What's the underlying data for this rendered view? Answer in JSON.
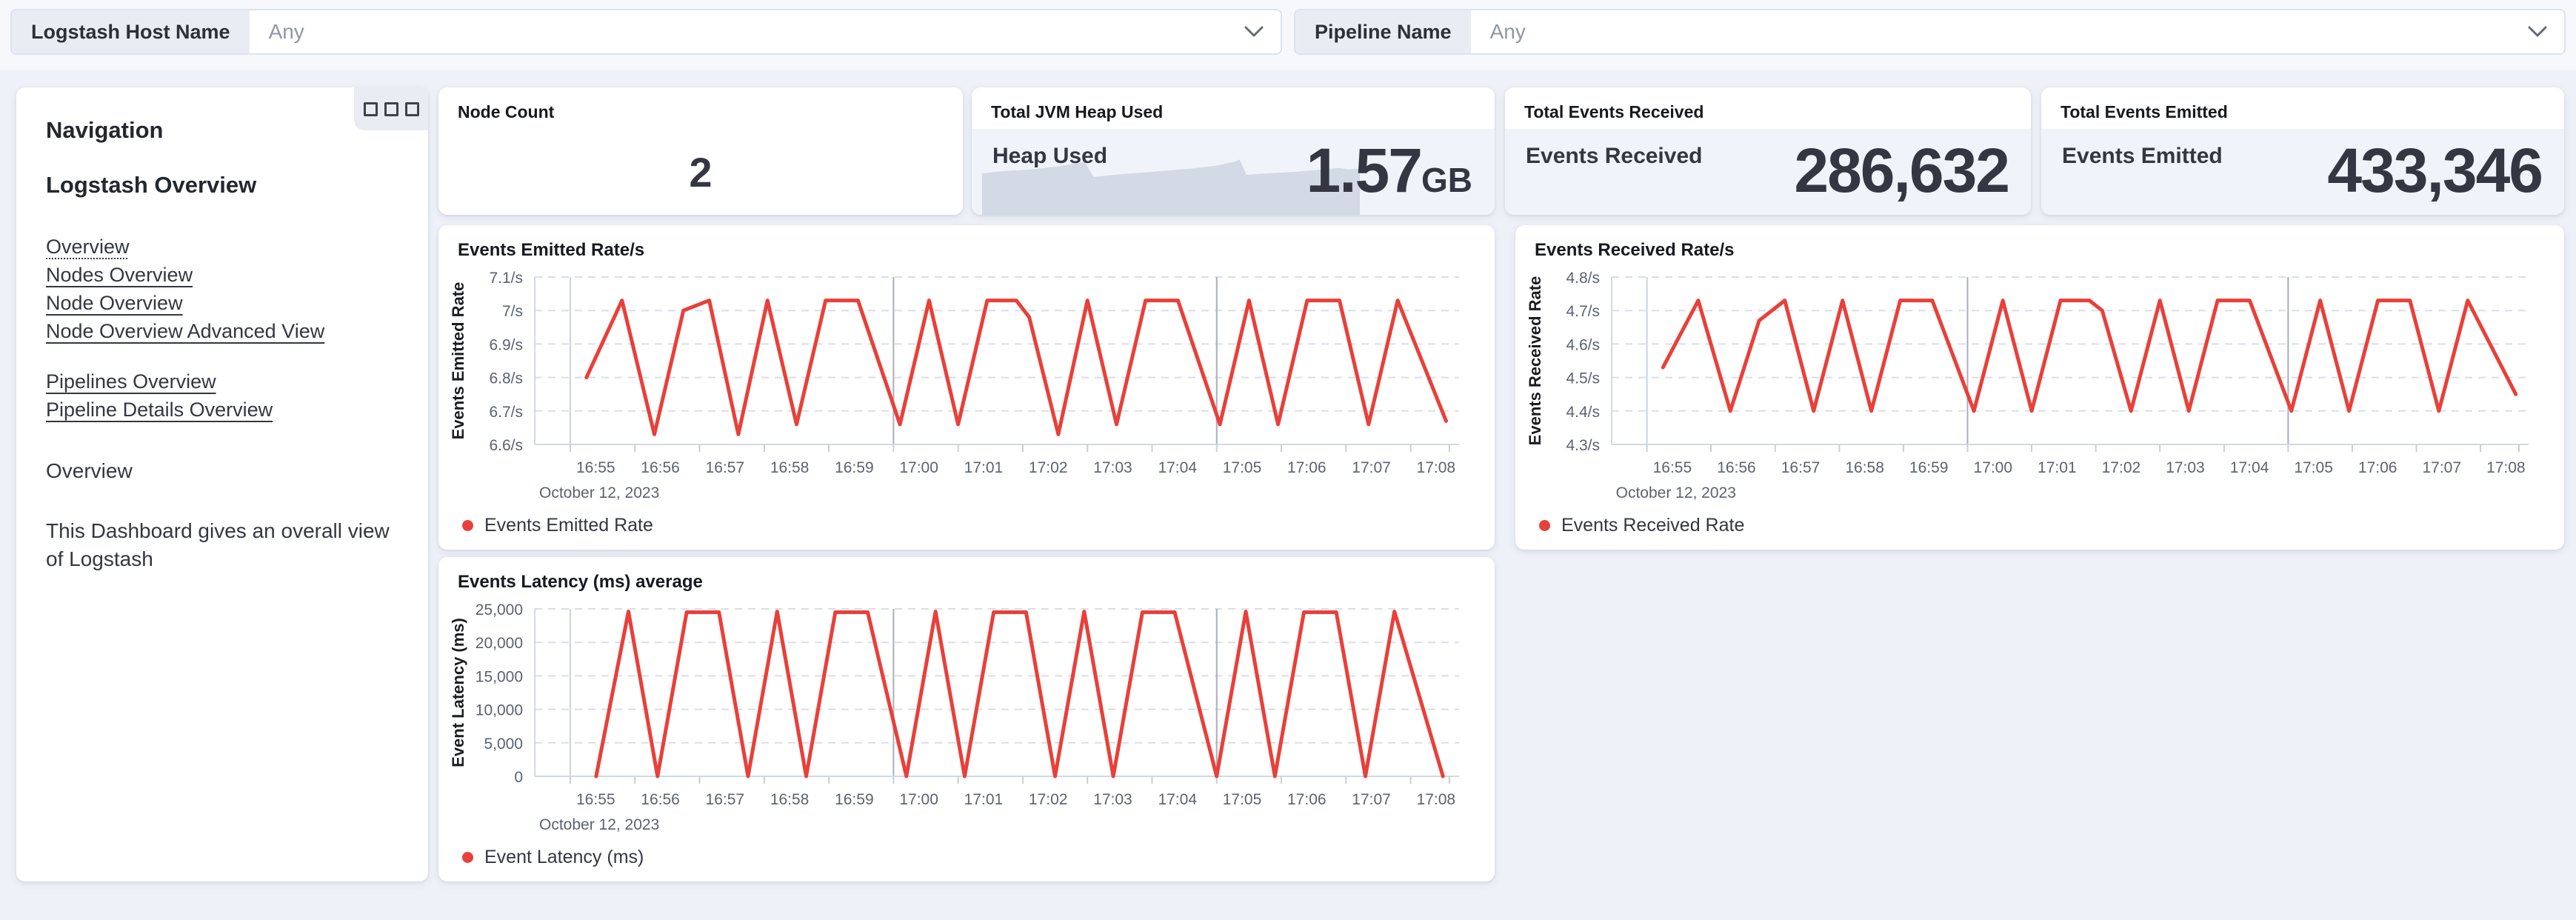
{
  "colors": {
    "series_red": "#e8403a",
    "sparkline_fill": "#d3dae6",
    "page_background": "#eef1f8"
  },
  "filters": {
    "host_label": "Logstash Host Name",
    "host_value": "Any",
    "pipeline_label": "Pipeline Name",
    "pipeline_value": "Any"
  },
  "sidebar": {
    "title": "Navigation",
    "subtitle": "Logstash Overview",
    "links_primary": [
      "Overview",
      "Nodes Overview",
      "Node Overview",
      "Node Overview Advanced View"
    ],
    "links_secondary": [
      "Pipelines Overview",
      "Pipeline Details Overview"
    ],
    "section_heading": "Overview",
    "description": "This Dashboard gives an overall view of Logstash"
  },
  "metrics": {
    "node_count": {
      "title": "Node Count",
      "value": "2"
    },
    "jvm_heap": {
      "title": "Total JVM Heap Used",
      "label": "Heap Used",
      "value": "1.57",
      "unit": "GB",
      "sparkline": [
        [
          0,
          0.45
        ],
        [
          0.06,
          0.42
        ],
        [
          0.13,
          0.4
        ],
        [
          0.2,
          0.36
        ],
        [
          0.26,
          0.31
        ],
        [
          0.272,
          0.3
        ],
        [
          0.295,
          0.5
        ],
        [
          0.35,
          0.47
        ],
        [
          0.45,
          0.43
        ],
        [
          0.55,
          0.39
        ],
        [
          0.62,
          0.35
        ],
        [
          0.665,
          0.3
        ],
        [
          0.682,
          0.27
        ],
        [
          0.7,
          0.47
        ],
        [
          0.76,
          0.45
        ],
        [
          0.83,
          0.43
        ],
        [
          0.9,
          0.4
        ],
        [
          0.945,
          0.38
        ],
        [
          0.97,
          0.4
        ],
        [
          1,
          0.39
        ]
      ]
    },
    "events_received": {
      "title": "Total Events Received",
      "label": "Events Received",
      "value": "286,632"
    },
    "events_emitted": {
      "title": "Total Events Emitted",
      "label": "Events Emitted",
      "value": "433,346"
    }
  },
  "chart_data": [
    {
      "type": "line",
      "title": "Events Emitted Rate/s",
      "ylabel": "Events Emitted Rate",
      "legend": "Events Emitted Rate",
      "color": "#e8403a",
      "ylim": [
        6.6,
        7.1
      ],
      "xlim": [
        -0.55,
        13.75
      ],
      "t_unit": "minutes since 16:55",
      "date_label": "October 12, 2023",
      "y_ticks": [
        {
          "v": 7.1,
          "label": "7.1/s"
        },
        {
          "v": 7.0,
          "label": "7/s"
        },
        {
          "v": 6.9,
          "label": "6.9/s"
        },
        {
          "v": 6.8,
          "label": "6.8/s"
        },
        {
          "v": 6.7,
          "label": "6.7/s"
        },
        {
          "v": 6.6,
          "label": "6.6/s"
        }
      ],
      "x_ticks": [
        {
          "t": 0,
          "label": "16:55"
        },
        {
          "t": 1,
          "label": "16:56"
        },
        {
          "t": 2,
          "label": "16:57"
        },
        {
          "t": 3,
          "label": "16:58"
        },
        {
          "t": 4,
          "label": "16:59"
        },
        {
          "t": 5,
          "label": "17:00"
        },
        {
          "t": 6,
          "label": "17:01"
        },
        {
          "t": 7,
          "label": "17:02"
        },
        {
          "t": 8,
          "label": "17:03"
        },
        {
          "t": 9,
          "label": "17:04"
        },
        {
          "t": 10,
          "label": "17:05"
        },
        {
          "t": 11,
          "label": "17:06"
        },
        {
          "t": 12,
          "label": "17:07"
        },
        {
          "t": 13,
          "label": "17:08"
        },
        {
          "t": 13.6,
          "label": ""
        }
      ],
      "x_gridlines": [
        {
          "t": 0,
          "emphasis": false
        },
        {
          "t": 5,
          "emphasis": true
        },
        {
          "t": 10,
          "emphasis": true
        }
      ],
      "points": [
        [
          0.25,
          6.8
        ],
        [
          0.8,
          7.03
        ],
        [
          1.3,
          6.63
        ],
        [
          1.75,
          7.0
        ],
        [
          2.15,
          7.03
        ],
        [
          2.6,
          6.63
        ],
        [
          3.05,
          7.03
        ],
        [
          3.5,
          6.66
        ],
        [
          3.95,
          7.03
        ],
        [
          4.45,
          7.03
        ],
        [
          5.1,
          6.66
        ],
        [
          5.55,
          7.03
        ],
        [
          6.0,
          6.66
        ],
        [
          6.45,
          7.03
        ],
        [
          6.9,
          7.03
        ],
        [
          7.1,
          6.98
        ],
        [
          7.55,
          6.63
        ],
        [
          8.0,
          7.03
        ],
        [
          8.45,
          6.66
        ],
        [
          8.9,
          7.03
        ],
        [
          9.4,
          7.03
        ],
        [
          10.05,
          6.66
        ],
        [
          10.5,
          7.03
        ],
        [
          10.95,
          6.66
        ],
        [
          11.4,
          7.03
        ],
        [
          11.9,
          7.03
        ],
        [
          12.35,
          6.66
        ],
        [
          12.8,
          7.03
        ],
        [
          13.55,
          6.67
        ]
      ]
    },
    {
      "type": "line",
      "title": "Events Received Rate/s",
      "ylabel": "Events Received Rate",
      "legend": "Events Received Rate",
      "color": "#e8403a",
      "ylim": [
        4.3,
        4.8
      ],
      "xlim": [
        -0.55,
        13.75
      ],
      "t_unit": "minutes since 16:55",
      "date_label": "October 12, 2023",
      "y_ticks": [
        {
          "v": 4.8,
          "label": "4.8/s"
        },
        {
          "v": 4.7,
          "label": "4.7/s"
        },
        {
          "v": 4.6,
          "label": "4.6/s"
        },
        {
          "v": 4.5,
          "label": "4.5/s"
        },
        {
          "v": 4.4,
          "label": "4.4/s"
        },
        {
          "v": 4.3,
          "label": "4.3/s"
        }
      ],
      "x_ticks": [
        {
          "t": 0,
          "label": "16:55"
        },
        {
          "t": 1,
          "label": "16:56"
        },
        {
          "t": 2,
          "label": "16:57"
        },
        {
          "t": 3,
          "label": "16:58"
        },
        {
          "t": 4,
          "label": "16:59"
        },
        {
          "t": 5,
          "label": "17:00"
        },
        {
          "t": 6,
          "label": "17:01"
        },
        {
          "t": 7,
          "label": "17:02"
        },
        {
          "t": 8,
          "label": "17:03"
        },
        {
          "t": 9,
          "label": "17:04"
        },
        {
          "t": 10,
          "label": "17:05"
        },
        {
          "t": 11,
          "label": "17:06"
        },
        {
          "t": 12,
          "label": "17:07"
        },
        {
          "t": 13,
          "label": "17:08"
        },
        {
          "t": 13.6,
          "label": ""
        }
      ],
      "x_gridlines": [
        {
          "t": 0,
          "emphasis": false
        },
        {
          "t": 5,
          "emphasis": true
        },
        {
          "t": 10,
          "emphasis": true
        }
      ],
      "points": [
        [
          0.25,
          4.53
        ],
        [
          0.8,
          4.73
        ],
        [
          1.3,
          4.4
        ],
        [
          1.75,
          4.67
        ],
        [
          2.15,
          4.73
        ],
        [
          2.6,
          4.4
        ],
        [
          3.05,
          4.73
        ],
        [
          3.5,
          4.4
        ],
        [
          3.95,
          4.73
        ],
        [
          4.45,
          4.73
        ],
        [
          5.1,
          4.4
        ],
        [
          5.55,
          4.73
        ],
        [
          6.0,
          4.4
        ],
        [
          6.45,
          4.73
        ],
        [
          6.9,
          4.73
        ],
        [
          7.1,
          4.7
        ],
        [
          7.55,
          4.4
        ],
        [
          8.0,
          4.73
        ],
        [
          8.45,
          4.4
        ],
        [
          8.9,
          4.73
        ],
        [
          9.4,
          4.73
        ],
        [
          10.05,
          4.4
        ],
        [
          10.5,
          4.73
        ],
        [
          10.95,
          4.4
        ],
        [
          11.4,
          4.73
        ],
        [
          11.9,
          4.73
        ],
        [
          12.35,
          4.4
        ],
        [
          12.8,
          4.73
        ],
        [
          13.55,
          4.45
        ]
      ]
    },
    {
      "type": "line",
      "title": "Events Latency (ms) average",
      "ylabel": "Event Latency (ms)",
      "legend": "Event Latency (ms)",
      "color": "#e8403a",
      "ylim": [
        0,
        25000
      ],
      "xlim": [
        -0.55,
        13.75
      ],
      "t_unit": "minutes since 16:55",
      "date_label": "October 12, 2023",
      "y_ticks": [
        {
          "v": 25000,
          "label": "25,000"
        },
        {
          "v": 20000,
          "label": "20,000"
        },
        {
          "v": 15000,
          "label": "15,000"
        },
        {
          "v": 10000,
          "label": "10,000"
        },
        {
          "v": 5000,
          "label": "5,000"
        },
        {
          "v": 0,
          "label": "0"
        }
      ],
      "x_ticks": [
        {
          "t": 0,
          "label": "16:55"
        },
        {
          "t": 1,
          "label": "16:56"
        },
        {
          "t": 2,
          "label": "16:57"
        },
        {
          "t": 3,
          "label": "16:58"
        },
        {
          "t": 4,
          "label": "16:59"
        },
        {
          "t": 5,
          "label": "17:00"
        },
        {
          "t": 6,
          "label": "17:01"
        },
        {
          "t": 7,
          "label": "17:02"
        },
        {
          "t": 8,
          "label": "17:03"
        },
        {
          "t": 9,
          "label": "17:04"
        },
        {
          "t": 10,
          "label": "17:05"
        },
        {
          "t": 11,
          "label": "17:06"
        },
        {
          "t": 12,
          "label": "17:07"
        },
        {
          "t": 13,
          "label": "17:08"
        },
        {
          "t": 13.6,
          "label": ""
        }
      ],
      "x_gridlines": [
        {
          "t": 0,
          "emphasis": false
        },
        {
          "t": 5,
          "emphasis": true
        },
        {
          "t": 10,
          "emphasis": true
        }
      ],
      "points": [
        [
          0.4,
          0
        ],
        [
          0.9,
          24600
        ],
        [
          1.35,
          0
        ],
        [
          1.8,
          24500
        ],
        [
          2.3,
          24500
        ],
        [
          2.75,
          0
        ],
        [
          3.2,
          24600
        ],
        [
          3.65,
          0
        ],
        [
          4.1,
          24500
        ],
        [
          4.6,
          24500
        ],
        [
          5.2,
          0
        ],
        [
          5.65,
          24600
        ],
        [
          6.1,
          0
        ],
        [
          6.55,
          24500
        ],
        [
          7.05,
          24500
        ],
        [
          7.5,
          0
        ],
        [
          7.95,
          24600
        ],
        [
          8.4,
          0
        ],
        [
          8.85,
          24500
        ],
        [
          9.35,
          24500
        ],
        [
          10.0,
          0
        ],
        [
          10.45,
          24600
        ],
        [
          10.9,
          0
        ],
        [
          11.35,
          24500
        ],
        [
          11.85,
          24500
        ],
        [
          12.3,
          0
        ],
        [
          12.75,
          24600
        ],
        [
          13.5,
          0
        ]
      ]
    }
  ]
}
